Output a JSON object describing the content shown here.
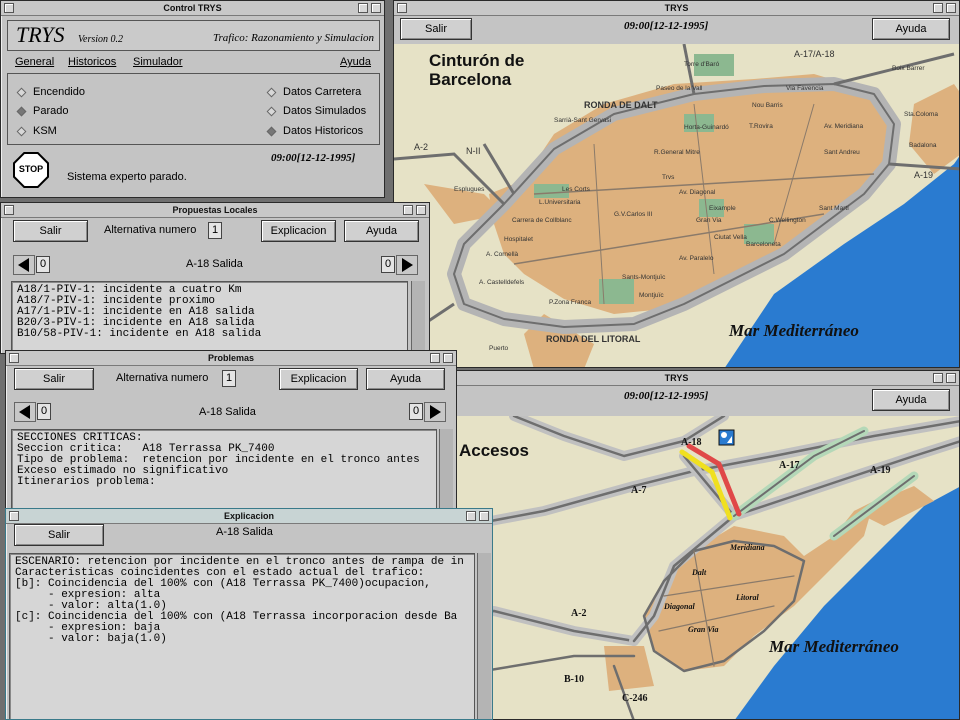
{
  "control": {
    "title": "Control TRYS",
    "logo": "TRYS",
    "version": "Version 0.2",
    "subtitle": "Trafico: Razonamiento y Simulacion",
    "menu": [
      "General",
      "Historicos",
      "Simulador"
    ],
    "help": "Ayuda",
    "radios_left": [
      "Encendido",
      "Parado",
      "KSM"
    ],
    "radios_right": [
      "Datos Carretera",
      "Datos Simulados",
      "Datos Historicos"
    ],
    "time": "09:00[12-12-1995]",
    "status": "Sistema experto parado.",
    "stop_icon": "STOP"
  },
  "map1": {
    "title": "TRYS",
    "exit": "Salir",
    "time": "09:00[12-12-1995]",
    "help": "Ayuda",
    "heading": "Cinturón de Barcelona",
    "sea": "Mar Mediterráneo",
    "road_labels": [
      "A-17/A-18",
      "A-2",
      "N-II",
      "A-19",
      "RONDA DE DALT",
      "RONDA DEL LITORAL"
    ],
    "places": [
      "Torre d'Baró",
      "Paseo de la Vall",
      "Via Favencia",
      "Boix Barrer",
      "Nou Barris",
      "T.Rovira",
      "Av. Meridiana",
      "Sta.Coloma",
      "Sarrià-Sant Gervasi",
      "Horta-Guinardó",
      "Badalona",
      "R.General Mitre",
      "Sant Andreu",
      "Esplugues",
      "Les Corts",
      "Trvs",
      "L.Universitaria",
      "Av. Diagonal",
      "Carrera de Collblanc",
      "G.V.Carlos III",
      "Gran Via",
      "Eixample",
      "C.Wellington",
      "Sant Martí",
      "Barceloneta",
      "Sants-Montjuïc",
      "Hospitalet",
      "A. Cornellà",
      "Av. Paralelo",
      "Ciutat Vella",
      "A. Castelldefels",
      "Montjuïc",
      "P.Zona Franca",
      "Puerto"
    ]
  },
  "map2": {
    "title": "TRYS",
    "time": "09:00[12-12-1995]",
    "help": "Ayuda",
    "heading": "Accesos",
    "sea": "Mar Mediterráneo",
    "road_labels": [
      "A-18",
      "A-17",
      "A-19",
      "A-7",
      "A-2",
      "B-10",
      "C-246"
    ],
    "districts": [
      "Meridiana",
      "Dalt",
      "Litoral",
      "Diagonal",
      "Gran Via"
    ]
  },
  "propuestas": {
    "title": "Propuestas Locales",
    "exit": "Salir",
    "alt_label": "Alternativa numero",
    "alt_value": "1",
    "explain": "Explicacion",
    "help": "Ayuda",
    "left_num": "0",
    "right_num": "0",
    "route": "A-18 Salida",
    "lines": [
      "A18/1-PIV-1: incidente a cuatro Km",
      "A18/7-PIV-1: incidente proximo",
      "A17/1-PIV-1: incidente en A18 salida",
      "B20/3-PIV-1: incidente en A18 salida",
      "B10/58-PIV-1: incidente en A18 salida"
    ]
  },
  "problemas": {
    "title": "Problemas",
    "exit": "Salir",
    "alt_label": "Alternativa numero",
    "alt_value": "1",
    "explain": "Explicacion",
    "help": "Ayuda",
    "left_num": "0",
    "right_num": "0",
    "route": "A-18 Salida",
    "lines": [
      "SECCIONES CRITICAS:",
      "",
      "Seccion critica:   A18 Terrassa PK_7400",
      "Tipo de problema:  retencion por incidente en el tronco antes",
      "Exceso estimado no significativo",
      "Itinerarios problema:"
    ]
  },
  "explicacion": {
    "title": "Explicacion",
    "exit": "Salir",
    "route": "A-18 Salida",
    "lines": [
      "ESCENARIO: retencion por incidente en el tronco antes de rampa de in",
      "",
      "Caracteristicas coincidentes con el estado actual del trafico:",
      "",
      "[b]: Coincidencia del 100% con (A18 Terrassa PK_7400)ocupacion,",
      "     - expresion: alta",
      "     - valor: alta(1.0)",
      "",
      "[c]: Coincidencia del 100% con (A18 Terrassa incorporacion desde Ba",
      "     - expresion: baja",
      "     - valor: baja(1.0)"
    ]
  },
  "colors": {
    "land": "#e6e2c6",
    "city": "#ddb17e",
    "sea": "#2a7bd0",
    "ring": "#b4b4b4",
    "road": "#6e6e6e",
    "park": "#8cb890",
    "incident_red": "#e04848",
    "incident_yellow": "#f0e020"
  }
}
